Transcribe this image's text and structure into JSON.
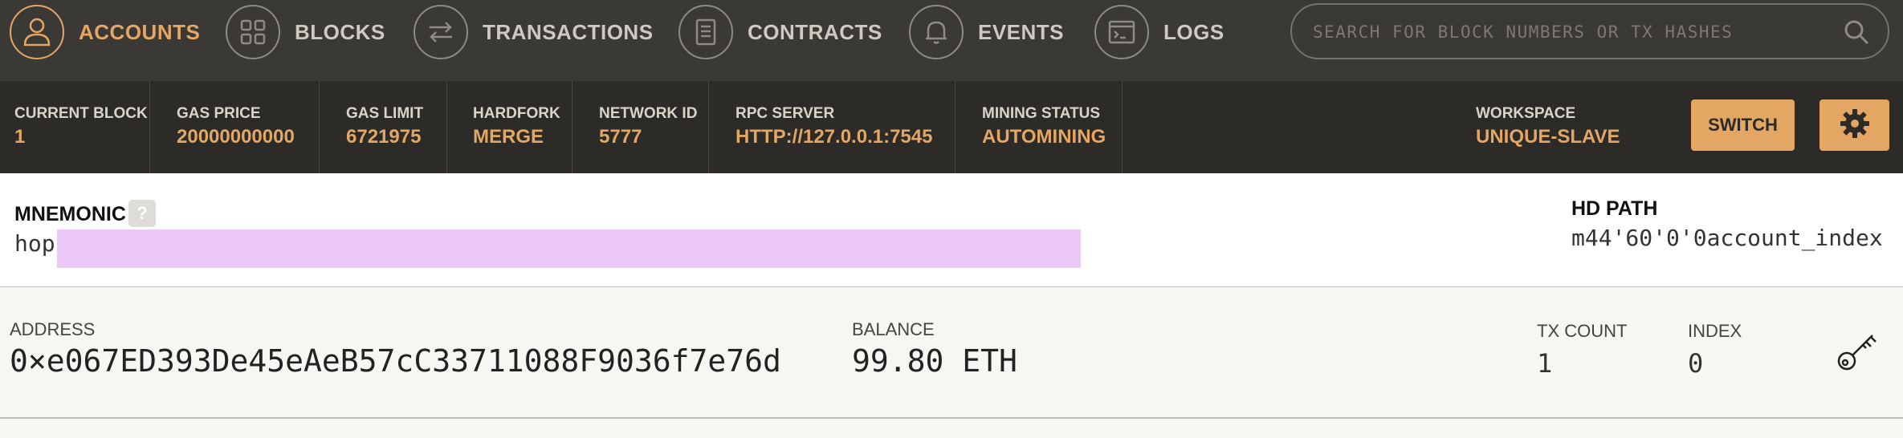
{
  "nav": {
    "items": [
      {
        "label": "ACCOUNTS",
        "icon": "user-icon",
        "active": true
      },
      {
        "label": "BLOCKS",
        "icon": "grid-icon",
        "active": false
      },
      {
        "label": "TRANSACTIONS",
        "icon": "transfer-arrows-icon",
        "active": false
      },
      {
        "label": "CONTRACTS",
        "icon": "document-icon",
        "active": false
      },
      {
        "label": "EVENTS",
        "icon": "bell-icon",
        "active": false
      },
      {
        "label": "LOGS",
        "icon": "terminal-icon",
        "active": false
      }
    ],
    "search_placeholder": "SEARCH FOR BLOCK NUMBERS OR TX HASHES"
  },
  "status": {
    "current_block": {
      "label": "CURRENT BLOCK",
      "value": "1"
    },
    "gas_price": {
      "label": "GAS PRICE",
      "value": "20000000000"
    },
    "gas_limit": {
      "label": "GAS LIMIT",
      "value": "6721975"
    },
    "hardfork": {
      "label": "HARDFORK",
      "value": "MERGE"
    },
    "network_id": {
      "label": "NETWORK ID",
      "value": "5777"
    },
    "rpc_server": {
      "label": "RPC SERVER",
      "value": "HTTP://127.0.0.1:7545"
    },
    "mining_status": {
      "label": "MINING STATUS",
      "value": "AUTOMINING"
    },
    "workspace": {
      "label": "WORKSPACE",
      "value": "UNIQUE-SLAVE"
    },
    "switch_label": "SWITCH"
  },
  "mnemonic": {
    "label": "MNEMONIC",
    "help": "?",
    "visible_word": "hop",
    "hd_path_label": "HD PATH",
    "hd_path_value": "m44'60'0'0account_index"
  },
  "account": {
    "address_label": "ADDRESS",
    "address": "0×e067ED393De45eAeB57cC33711088F9036f7e76d",
    "balance_label": "BALANCE",
    "balance": "99.80 ETH",
    "tx_count_label": "TX COUNT",
    "tx_count": "1",
    "index_label": "INDEX",
    "index": "0"
  },
  "colors": {
    "accent": "#e4a663",
    "nav_bg": "#3b3935",
    "status_bg": "#2d2b28",
    "mnemonic_mask": "#ebc8f6"
  }
}
